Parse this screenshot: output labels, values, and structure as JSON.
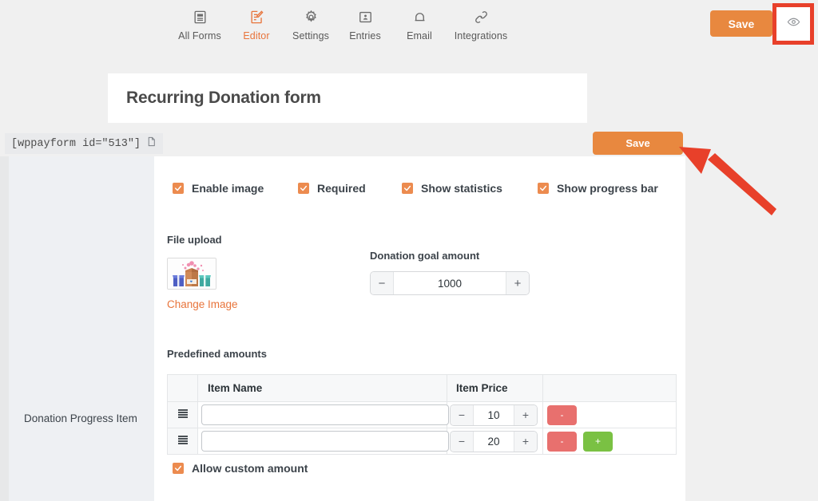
{
  "theme": {
    "orange": "#e8883f",
    "orange_text": "#e8743b",
    "annotation_red": "#e8402a",
    "remove_red": "#e8706e",
    "add_green": "#7ac143",
    "page_bg": "#f0f0f0",
    "panel_bg": "#eef0f3"
  },
  "nav": {
    "tabs": [
      {
        "label": "All Forms",
        "icon": "forms-icon",
        "active": false
      },
      {
        "label": "Editor",
        "icon": "editor-pencil-icon",
        "active": true
      },
      {
        "label": "Settings",
        "icon": "gear-icon",
        "active": false
      },
      {
        "label": "Entries",
        "icon": "entries-card-icon",
        "active": false
      },
      {
        "label": "Email",
        "icon": "bell-icon",
        "active": false
      },
      {
        "label": "Integrations",
        "icon": "link-chain-icon",
        "active": false
      }
    ]
  },
  "header_actions": {
    "save_label": "Save",
    "preview_icon": "eye-icon",
    "preview_highlighted": true
  },
  "form": {
    "title": "Recurring Donation form",
    "shortcode": "[wppayform id=\"513\"]",
    "shortcode_copy_icon": "copy-document-icon",
    "save_label": "Save"
  },
  "sidebar": {
    "field_label": "Donation Progress Item"
  },
  "editor": {
    "toggles": [
      {
        "label": "Enable image",
        "checked": true
      },
      {
        "label": "Required",
        "checked": true
      },
      {
        "label": "Show statistics",
        "checked": true
      },
      {
        "label": "Show progress bar",
        "checked": true
      }
    ],
    "file_upload": {
      "label": "File upload",
      "change_image_label": "Change Image",
      "thumbnail_alt": "donation-box-hearts-image"
    },
    "goal": {
      "label": "Donation goal amount",
      "value": "1000",
      "minus_label": "−",
      "plus_label": "+"
    },
    "predefined": {
      "label": "Predefined amounts",
      "columns": [
        "",
        "Item Name",
        "Item Price",
        ""
      ],
      "rows": [
        {
          "handle_icon": "drag-handle-icon",
          "name": "",
          "name_placeholder": "",
          "price": "10",
          "remove_label": "-",
          "add_label": "",
          "has_add": false
        },
        {
          "handle_icon": "drag-handle-icon",
          "name": "",
          "name_placeholder": "",
          "price": "20",
          "remove_label": "-",
          "add_label": "+",
          "has_add": true
        }
      ]
    },
    "allow_custom": {
      "label": "Allow custom amount",
      "checked": true
    }
  }
}
